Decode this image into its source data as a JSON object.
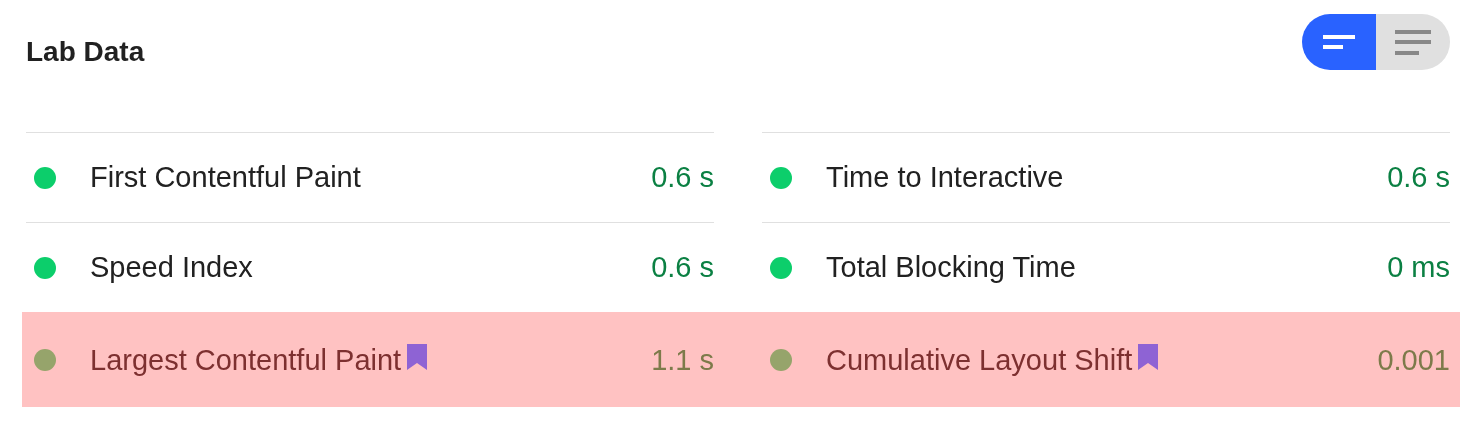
{
  "title": "Lab Data",
  "view_toggle": [
    {
      "selected": true
    },
    {
      "selected": false
    }
  ],
  "rows": [
    {
      "highlighted": false,
      "metrics": [
        {
          "name": "First Contentful Paint",
          "value": "0.6 s",
          "color": "#0cce6b",
          "marked": false
        },
        {
          "name": "Time to Interactive",
          "value": "0.6 s",
          "color": "#0cce6b",
          "marked": false
        }
      ]
    },
    {
      "highlighted": false,
      "metrics": [
        {
          "name": "Speed Index",
          "value": "0.6 s",
          "color": "#0cce6b",
          "marked": false
        },
        {
          "name": "Total Blocking Time",
          "value": "0 ms",
          "color": "#0cce6b",
          "marked": false
        }
      ]
    },
    {
      "highlighted": true,
      "metrics": [
        {
          "name": "Largest Contentful Paint",
          "value": "1.1 s",
          "color": "#96a46b",
          "marked": true
        },
        {
          "name": "Cumulative Layout Shift",
          "value": "0.001",
          "color": "#96a46b",
          "marked": true
        }
      ]
    }
  ]
}
